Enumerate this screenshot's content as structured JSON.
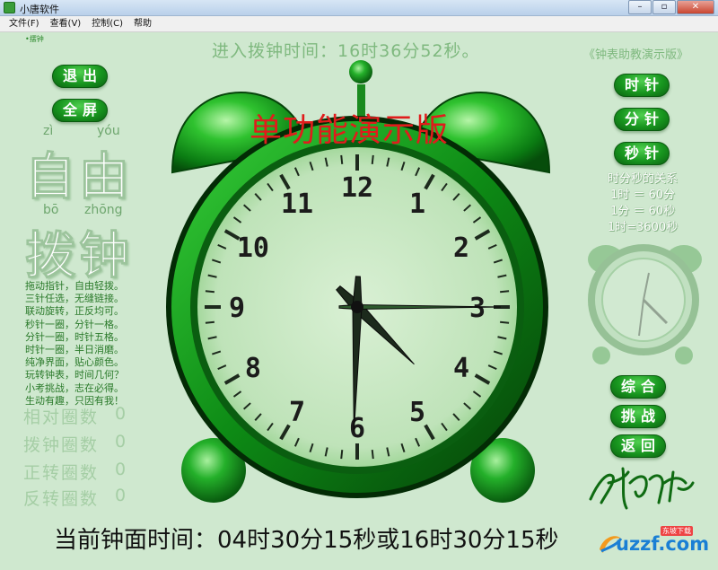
{
  "window": {
    "title": "小唐软件",
    "min_label": "–",
    "max_label": "▫",
    "close_label": "✕"
  },
  "menu": [
    "文件(F)",
    "查看(V)",
    "控制(C)",
    "帮助"
  ],
  "app": {
    "tiny_label": "•摆钟",
    "top_time": "进入拨钟时间：16时36分52秒。",
    "demo_note": "《钟表助教演示版》",
    "banner": "单功能演示版",
    "buttons_left": {
      "exit": "退出",
      "fullscreen": "全屏"
    },
    "pinyin": {
      "zi": "zì",
      "you": "yóu",
      "bo": "bō",
      "zhong": "zhōng"
    },
    "big_words": {
      "ziyou": "自由",
      "bozhong": "拨钟"
    },
    "poem": [
      "拖动指针，自由轻拨。",
      "三针任选，无缝链接。",
      "联动旋转，正反均可。",
      "秒针一圈，分针一格。",
      "分针一圈，时针五格。",
      "时针一圈，半日消磨。",
      "纯净界面，贴心颜色。",
      "玩转钟表，时间几何？",
      "小考挑战，志在必得。",
      "生动有趣，只因有我！"
    ],
    "counts": [
      {
        "label": "相对圈数",
        "value": "0"
      },
      {
        "label": "拨钟圈数",
        "value": "0"
      },
      {
        "label": "正转圈数",
        "value": "0"
      },
      {
        "label": "反转圈数",
        "value": "0"
      }
    ],
    "buttons_right": {
      "hour": "时针",
      "minute": "分针",
      "second": "秒针",
      "combined": "综合",
      "challenge": "挑战",
      "back": "返回"
    },
    "relation": {
      "title": "时分秒的关系",
      "lines": [
        "1时 ＝ 60分",
        "1分 ＝ 60秒",
        "1时=3600秒"
      ]
    },
    "clock": {
      "numbers": [
        "12",
        "1",
        "2",
        "3",
        "4",
        "5",
        "6",
        "7",
        "8",
        "9",
        "10",
        "11"
      ],
      "hour": 4,
      "minute": 30,
      "second": 15
    },
    "bottom_time": "当前钟面时间：04时30分15秒或16时30分15秒",
    "watermark": {
      "text": "uzzf.com",
      "badge": "东坡下载"
    }
  },
  "colors": {
    "background": "#cfe8cf",
    "button_green": "#18961f",
    "banner_red": "#e01c1c",
    "clock_dark": "#0b5e14"
  }
}
